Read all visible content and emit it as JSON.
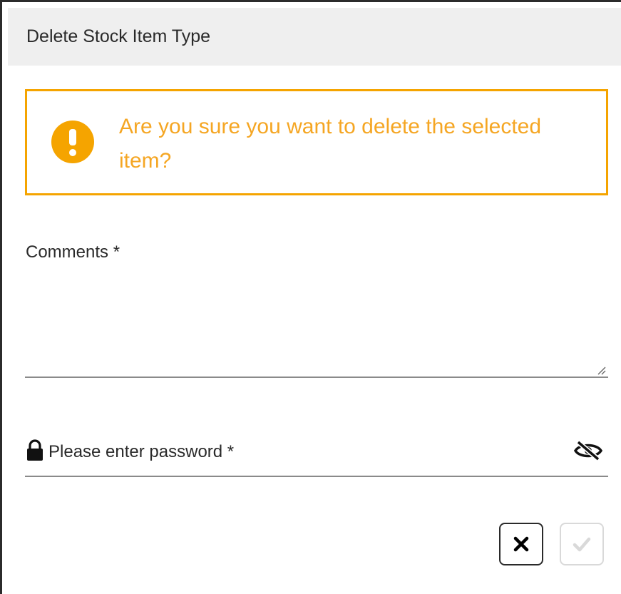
{
  "dialog": {
    "title": "Delete Stock Item Type"
  },
  "alert": {
    "icon": "exclamation-circle-icon",
    "message": "Are you sure you want to delete the selected item?",
    "color": "#f5a400"
  },
  "comments": {
    "label": "Comments *",
    "value": ""
  },
  "password": {
    "icon": "lock-icon",
    "placeholder": "Please enter password *",
    "value": "",
    "toggle_icon": "eye-slash-icon"
  },
  "actions": {
    "cancel_icon": "close-icon",
    "confirm_icon": "check-icon",
    "confirm_disabled": true
  }
}
